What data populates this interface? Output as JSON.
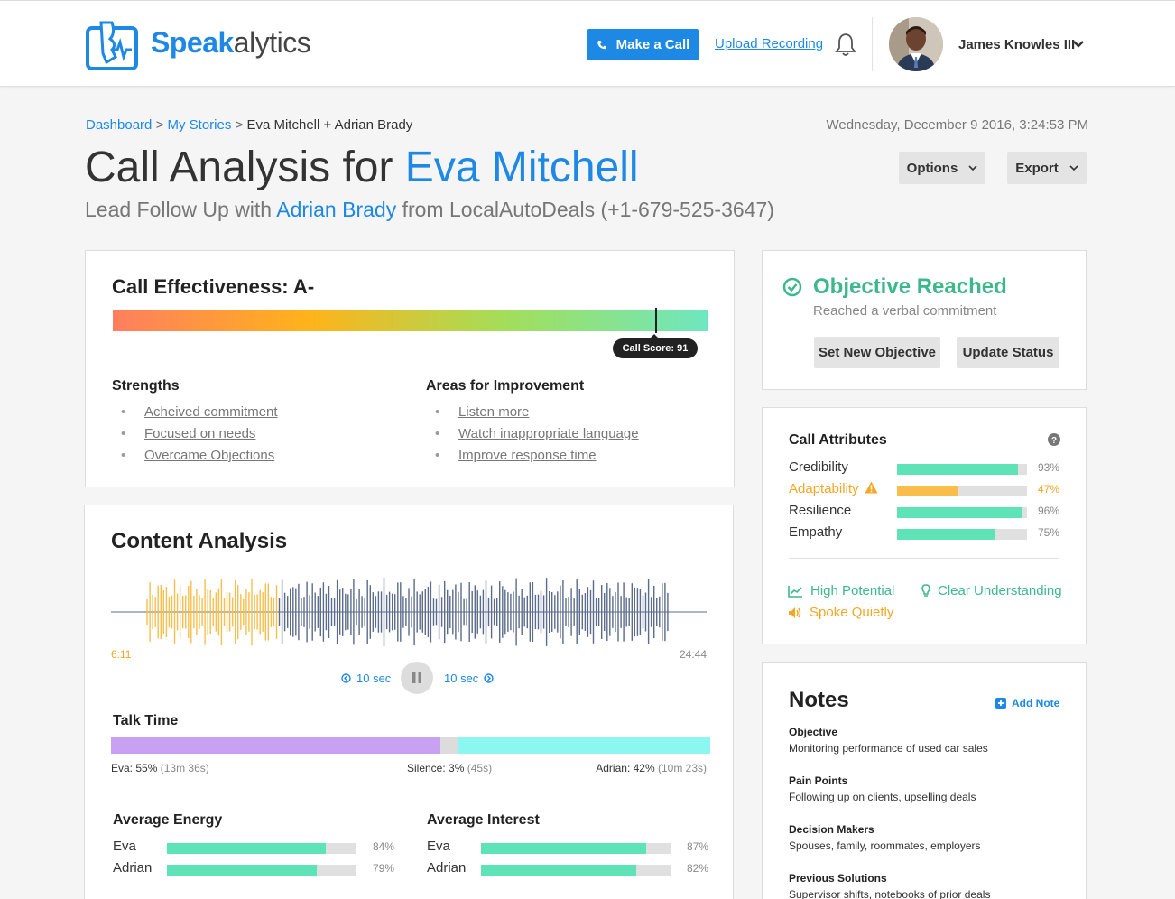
{
  "header": {
    "logo_bold": "Speak",
    "logo_light": "alytics",
    "make_call_label": "Make a Call",
    "upload_label": "Upload Recording",
    "user_name": "James Knowles III"
  },
  "breadcrumb": {
    "items": [
      "Dashboard",
      "My Stories",
      "Eva Mitchell + Adrian Brady"
    ],
    "separator": ">"
  },
  "datetime": "Wednesday, December 9 2016, 3:24:53 PM",
  "title": {
    "prefix": "Call Analysis for ",
    "name": "Eva Mitchell"
  },
  "subtitle": {
    "prefix": "Lead Follow Up with ",
    "name": "Adrian Brady",
    "suffix": " from LocalAutoDeals (+1-679-525-3647)"
  },
  "toolbar": {
    "options_label": "Options",
    "export_label": "Export"
  },
  "effectiveness": {
    "title": "Call Effectiveness: A-",
    "score": 91,
    "score_label": "Call Score: 91",
    "strengths_title": "Strengths",
    "strengths": [
      "Acheived commitment",
      "Focused on needs",
      "Overcame Objections"
    ],
    "improvement_title": "Areas for Improvement",
    "improvements": [
      "Listen more",
      "Watch inappropriate language",
      "Improve response time"
    ]
  },
  "objective": {
    "title": "Objective Reached",
    "subtitle": "Reached a verbal commitment",
    "set_label": "Set New Objective",
    "update_label": "Update Status"
  },
  "attributes": {
    "title": "Call Attributes",
    "items": [
      {
        "name": "Credibility",
        "pct": 93,
        "pct_label": "93%",
        "color": "#5ee3b6",
        "warning": false
      },
      {
        "name": "Adaptability",
        "pct": 47,
        "pct_label": "47%",
        "color": "#f9bd4a",
        "warning": true
      },
      {
        "name": "Resilience",
        "pct": 96,
        "pct_label": "96%",
        "color": "#5ee3b6",
        "warning": false
      },
      {
        "name": "Empathy",
        "pct": 75,
        "pct_label": "75%",
        "color": "#5ee3b6",
        "warning": false
      }
    ],
    "tags": [
      "High Potential",
      "Clear Understanding",
      "Spoke Quietly"
    ]
  },
  "notes": {
    "title": "Notes",
    "add_label": "Add Note",
    "items": [
      {
        "heading": "Objective",
        "text": "Monitoring performance of used car sales"
      },
      {
        "heading": "Pain Points",
        "text": "Following up on clients, upselling deals"
      },
      {
        "heading": "Decision Makers",
        "text": "Spouses, family, roommates, employers"
      },
      {
        "heading": "Previous Solutions",
        "text": "Supervisor shifts, notebooks of prior deals"
      }
    ]
  },
  "content_analysis": {
    "title": "Content Analysis",
    "elapsed": "6:11",
    "duration": "24:44",
    "skip_back_label": "10 sec",
    "skip_fwd_label": "10 sec",
    "played_fraction": 0.25,
    "talk_time": {
      "title": "Talk Time",
      "segments": [
        {
          "who": "Eva",
          "pct": 55,
          "label": "Eva: 55%",
          "detail": "(13m 36s)",
          "color": "#c9a1f2"
        },
        {
          "who": "Silence",
          "pct": 3,
          "label": "Silence: 3%",
          "detail": "(45s)",
          "color": "#dcdcdc"
        },
        {
          "who": "Adrian",
          "pct": 42,
          "label": "Adrian: 42%",
          "detail": "(10m 23s)",
          "color": "#8cf7f0"
        }
      ]
    },
    "energy": {
      "title": "Average Energy",
      "rows": [
        {
          "name": "Eva",
          "pct": 84,
          "pct_label": "84%"
        },
        {
          "name": "Adrian",
          "pct": 79,
          "pct_label": "79%"
        }
      ]
    },
    "interest": {
      "title": "Average Interest",
      "rows": [
        {
          "name": "Eva",
          "pct": 87,
          "pct_label": "87%"
        },
        {
          "name": "Adrian",
          "pct": 82,
          "pct_label": "82%"
        }
      ]
    }
  },
  "colors": {
    "brand": "#1e88e5",
    "success": "#3cb88c",
    "warning": "#f5a623",
    "bar_fill": "#5ee3b6"
  }
}
